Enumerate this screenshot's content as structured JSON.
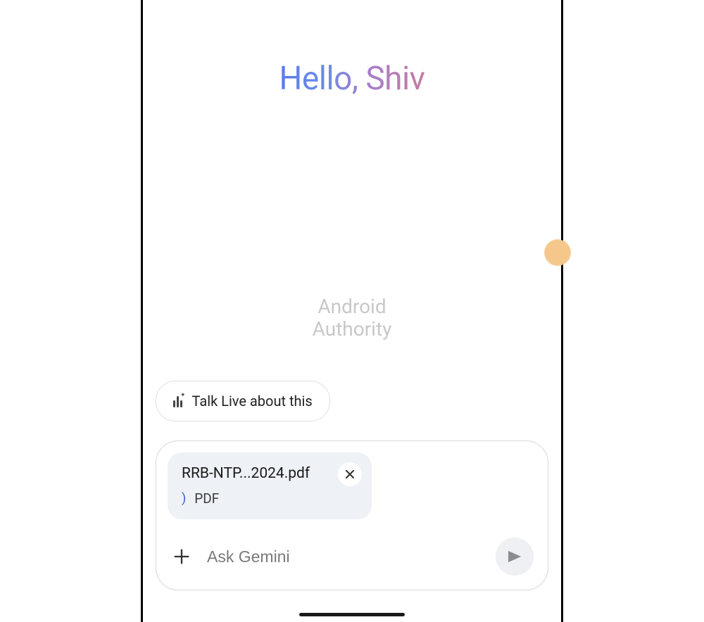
{
  "greeting": "Hello, Shiv",
  "watermark": {
    "line1": "Android",
    "line2": "Authority"
  },
  "suggestion": {
    "label": "Talk Live about this"
  },
  "attachment": {
    "filename": "RRB-NTP...2024.pdf",
    "type": "PDF"
  },
  "input": {
    "placeholder": "Ask Gemini"
  }
}
